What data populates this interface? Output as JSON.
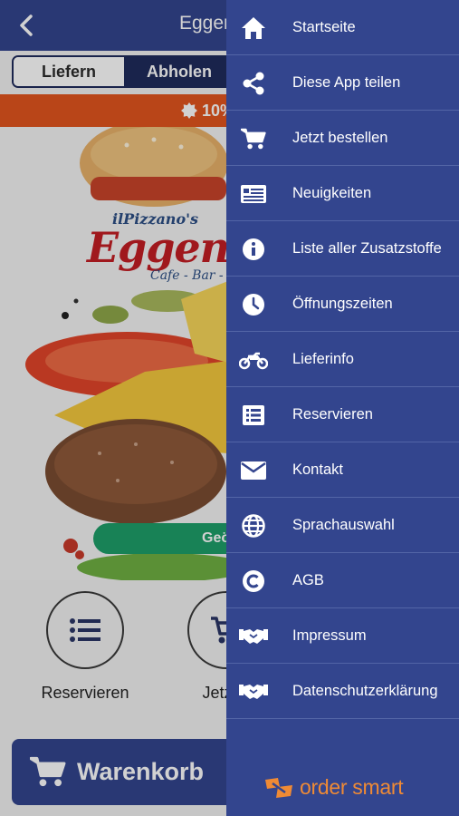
{
  "app": {
    "title": "Eggen",
    "back_icon": "chevron-left-icon",
    "segment": {
      "option_delivery": "Liefern",
      "option_pickup": "Abholen",
      "selected": "Abholen"
    },
    "promo": {
      "text": "10%",
      "icon": "badge-icon"
    },
    "logo": {
      "small": "ilPizzano's",
      "main": "Eggen B",
      "sub": "Cafe - Bar - Bis"
    },
    "open_pill": "Geö",
    "quick_actions": [
      {
        "label": "Reservieren",
        "icon": "list-icon"
      },
      {
        "label": "Jetzt b",
        "icon": "cart-icon"
      }
    ],
    "cart_button": {
      "label": "Warenkorb",
      "icon": "cart-icon"
    }
  },
  "drawer": {
    "items": [
      {
        "label": "Startseite",
        "icon": "home-icon"
      },
      {
        "label": "Diese App teilen",
        "icon": "share-icon"
      },
      {
        "label": "Jetzt bestellen",
        "icon": "cart-icon"
      },
      {
        "label": "Neuigkeiten",
        "icon": "news-icon"
      },
      {
        "label": "Liste aller Zusatzstoffe",
        "icon": "info-icon"
      },
      {
        "label": "Öffnungszeiten",
        "icon": "clock-icon"
      },
      {
        "label": "Lieferinfo",
        "icon": "motorbike-icon"
      },
      {
        "label": "Reservieren",
        "icon": "list-icon"
      },
      {
        "label": "Kontakt",
        "icon": "envelope-icon"
      },
      {
        "label": "Sprachauswahl",
        "icon": "globe-icon"
      },
      {
        "label": "AGB",
        "icon": "copyright-icon"
      },
      {
        "label": "Impressum",
        "icon": "handshake-icon"
      },
      {
        "label": "Datenschutzerklärung",
        "icon": "handshake-icon"
      }
    ],
    "brand": {
      "text": "order smart",
      "icon": "ordersmart-logo-icon"
    }
  },
  "colors": {
    "primary": "#33458e",
    "dark_navy": "#1f2b5c",
    "promo_orange": "#e2551e",
    "open_green": "#1e9f6a",
    "brand_orange": "#ef8a35"
  }
}
